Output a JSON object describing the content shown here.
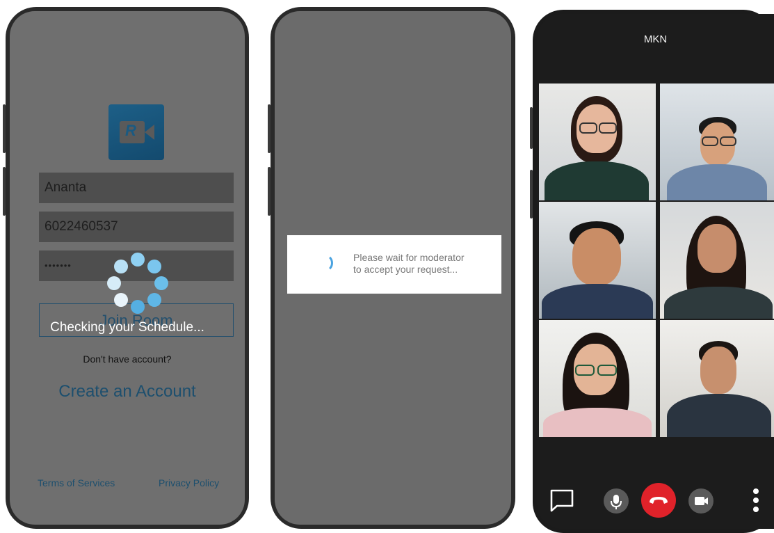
{
  "phone_login": {
    "logo_letter": "R",
    "username_value": "Ananta",
    "phone_value": "6022460537",
    "password_value": "•••••••",
    "join_button_label": "Join Room",
    "loading_text": "Checking your Schedule...",
    "no_account_text": "Don't have account?",
    "create_account_label": "Create an Account",
    "terms_label": "Terms of Services",
    "privacy_label": "Privacy Policy",
    "colors": {
      "brand": "#1d5f87",
      "spinner": "#8fd0f2",
      "link": "#1d4f6e"
    }
  },
  "phone_waiting": {
    "message_line1": "Please wait for moderator",
    "message_line2": "to accept your request...",
    "colors": {
      "spinner": "#4aa3e0"
    }
  },
  "phone_call": {
    "room_title": "MKN",
    "participants": [
      "participant-1",
      "participant-2",
      "participant-3",
      "participant-4",
      "participant-5",
      "participant-6"
    ],
    "controls": [
      "chat-icon",
      "microphone-icon",
      "end-call-icon",
      "camera-icon",
      "more-vertical-icon"
    ],
    "colors": {
      "end_call": "#e0222a",
      "control_bg": "#5a5a5a"
    }
  }
}
